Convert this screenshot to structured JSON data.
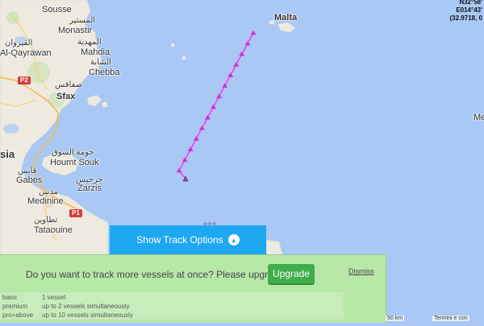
{
  "map": {
    "coordinates": [
      "N32°58'",
      "E014°43'",
      "(32.9718, 0"
    ],
    "places": {
      "sousse": "Sousse",
      "monastir_ar": "المستير",
      "monastir": "Monastir",
      "mahdia_ar": "المهدية",
      "mahdia": "Mahdia",
      "alqayrawan_ar": "القيروان",
      "alqayrawan": "Al-Qayrawan",
      "chebba_ar": "الشابة",
      "chebba": "Chebba",
      "sfax_ar": "صفاقس",
      "sfax": "Sfax",
      "houmt_souk_ar": "حومة السوق",
      "houmt_souk": "Houmt Souk",
      "sia": "sia",
      "gabes_ar": "قابس",
      "gabes": "Gabes",
      "zarzis_ar": "جرجيس",
      "zarzis": "Zarzis",
      "medinine_ar": "مدنين",
      "medinine": "Medinine",
      "tataouine_ar": "تطاوين",
      "tataouine": "Tataouine",
      "malta": "Malta",
      "me": "Me"
    },
    "road_badges": [
      "P2",
      "P1"
    ],
    "scale_label": "50 km",
    "terms_label": "Termini e con"
  },
  "track_toggle": {
    "label": "Show Track Options",
    "icon": "chevron-up-circle-icon"
  },
  "upgrade_panel": {
    "question": "Do you want to track more vessels at once? Please upgrade",
    "button_label": "Upgrade",
    "dismiss_label": "Dismiss",
    "plans": [
      {
        "plan": "basic",
        "limit": "1 vessel"
      },
      {
        "plan": "premium",
        "limit": "up to 2 vessels simultaneously"
      },
      {
        "plan": "pro+above",
        "limit": "up to 10 vessels simultaneously"
      }
    ]
  },
  "colors": {
    "sea": "#a9c8f4",
    "land": "#eeeae0",
    "track": "#ff33ff",
    "button": "#1fa8f2",
    "upgrade": "#3fae4a",
    "panel": "#b8e8a8"
  }
}
